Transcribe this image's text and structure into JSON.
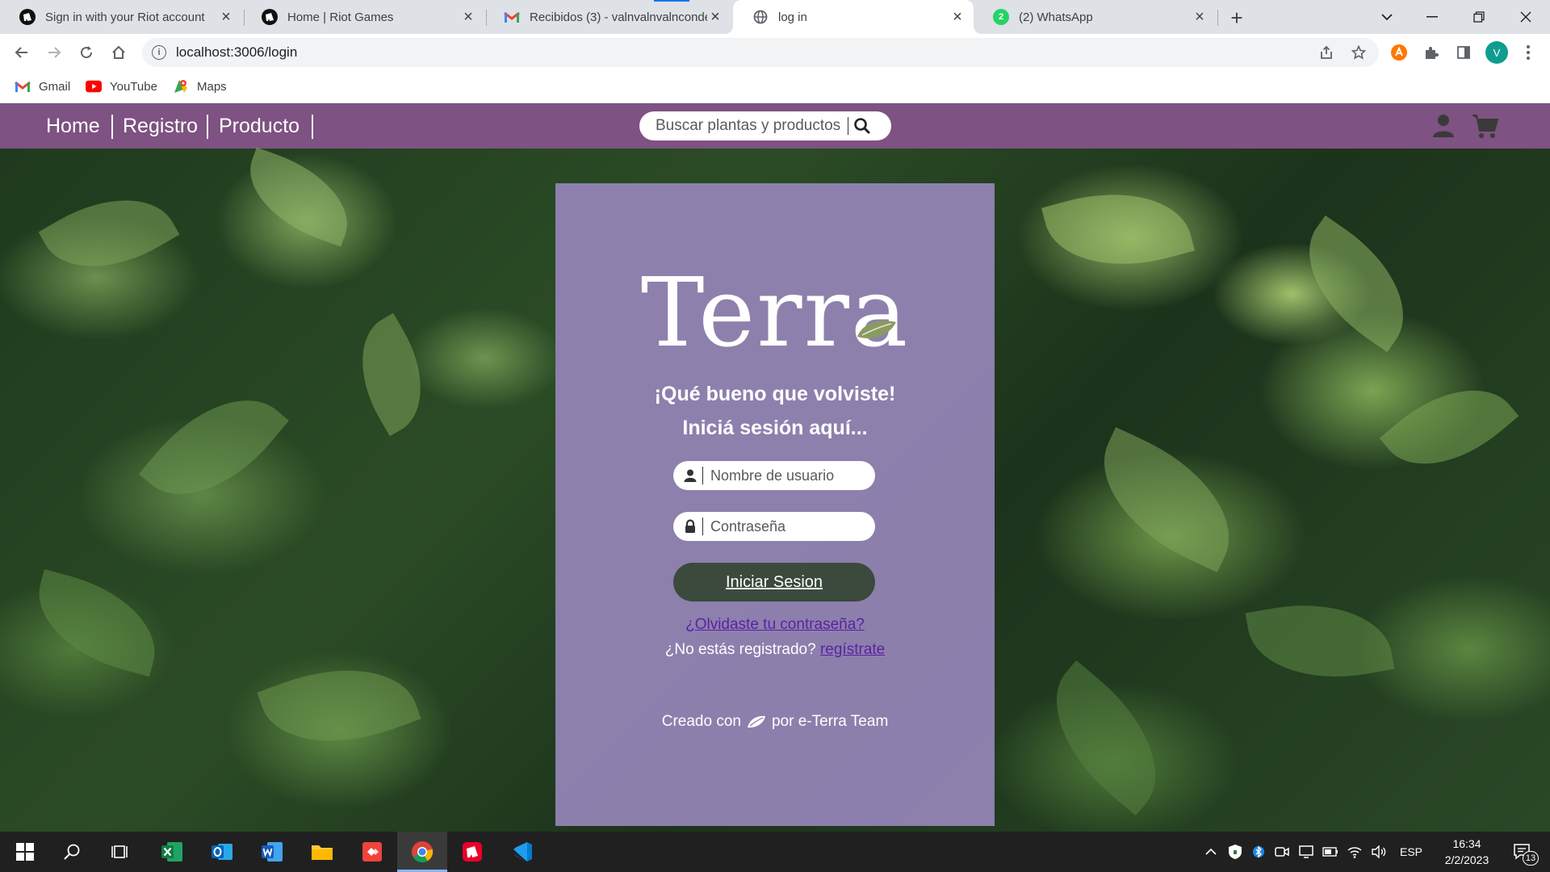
{
  "browser": {
    "tabs": [
      {
        "title": "Sign in with your Riot account",
        "icon": "riot-icon",
        "active": false
      },
      {
        "title": "Home | Riot Games",
        "icon": "riot-icon",
        "active": false
      },
      {
        "title": "Recibidos (3) - valnvalnvalnconde",
        "icon": "gmail-icon",
        "active": false
      },
      {
        "title": "log in",
        "icon": "globe-icon",
        "active": true
      },
      {
        "title": "(2) WhatsApp",
        "icon": "whatsapp-icon",
        "active": false
      }
    ],
    "url": "localhost:3006/login",
    "profile_initial": "V",
    "bookmarks": [
      {
        "label": "Gmail",
        "icon": "gmail-icon"
      },
      {
        "label": "YouTube",
        "icon": "youtube-icon"
      },
      {
        "label": "Maps",
        "icon": "maps-icon"
      }
    ]
  },
  "site": {
    "nav": {
      "links": [
        "Home",
        "Registro",
        "Producto"
      ],
      "search_placeholder": "Buscar plantas y productos",
      "icons": [
        "user-icon",
        "cart-icon"
      ]
    },
    "colors": {
      "nav_bg": "#7e5282",
      "card_bg": "#9182b2",
      "button_bg": "#3b4a3c",
      "link": "#5b21a5"
    },
    "login": {
      "logo": "Terra",
      "greeting_1": "¡Qué bueno que volviste!",
      "greeting_2": "Iniciá sesión aquí...",
      "username_placeholder": "Nombre de usuario",
      "password_placeholder": "Contraseña",
      "submit_label": "Iniciar Sesion",
      "forgot_link": "¿Olvidaste tu contraseña?",
      "register_prompt": "¿No estás registrado?",
      "register_link": "regístrate",
      "footer_prefix": "Creado con",
      "footer_suffix": "por e-Terra Team"
    }
  },
  "taskbar": {
    "apps": [
      "windows-start-icon",
      "search-icon",
      "task-view-icon",
      "excel-icon",
      "outlook-icon",
      "word-icon",
      "file-explorer-icon",
      "anydesk-icon",
      "chrome-icon",
      "riot-client-icon",
      "vscode-icon"
    ],
    "language": "ESP",
    "time": "16:34",
    "date": "2/2/2023",
    "notification_count": "13"
  }
}
